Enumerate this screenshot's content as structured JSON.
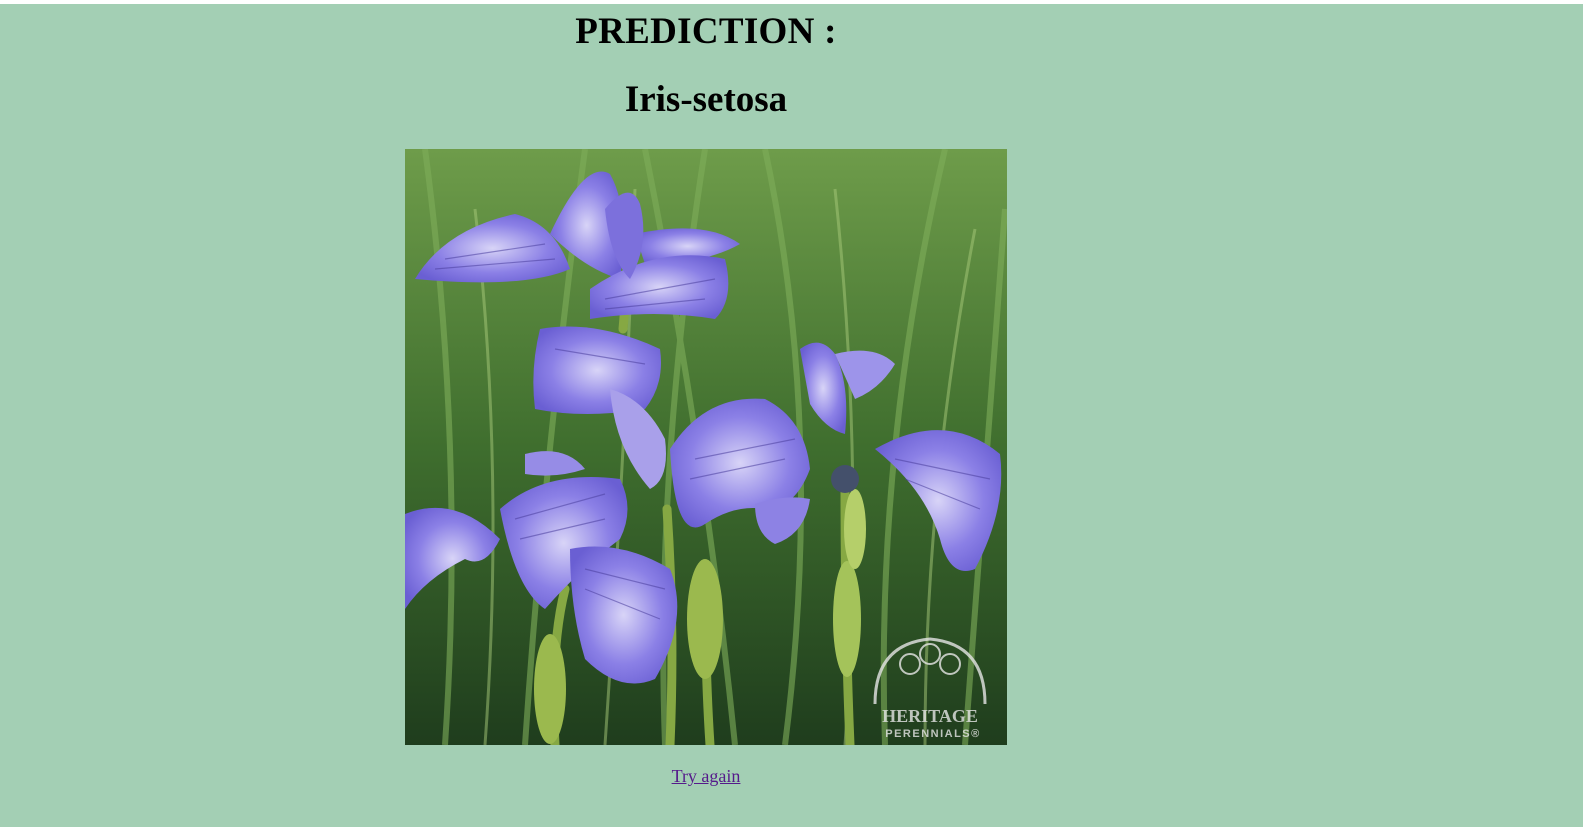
{
  "heading": {
    "title": "PREDICTION :",
    "result": "Iris-setosa"
  },
  "image": {
    "subject": "blue iris flowers",
    "watermark_text": [
      "HERITAGE",
      "PERENNIALS®"
    ]
  },
  "link": {
    "try_again": "Try again"
  },
  "colors": {
    "page_background": "#a3cfb4",
    "link": "#551a8b"
  }
}
